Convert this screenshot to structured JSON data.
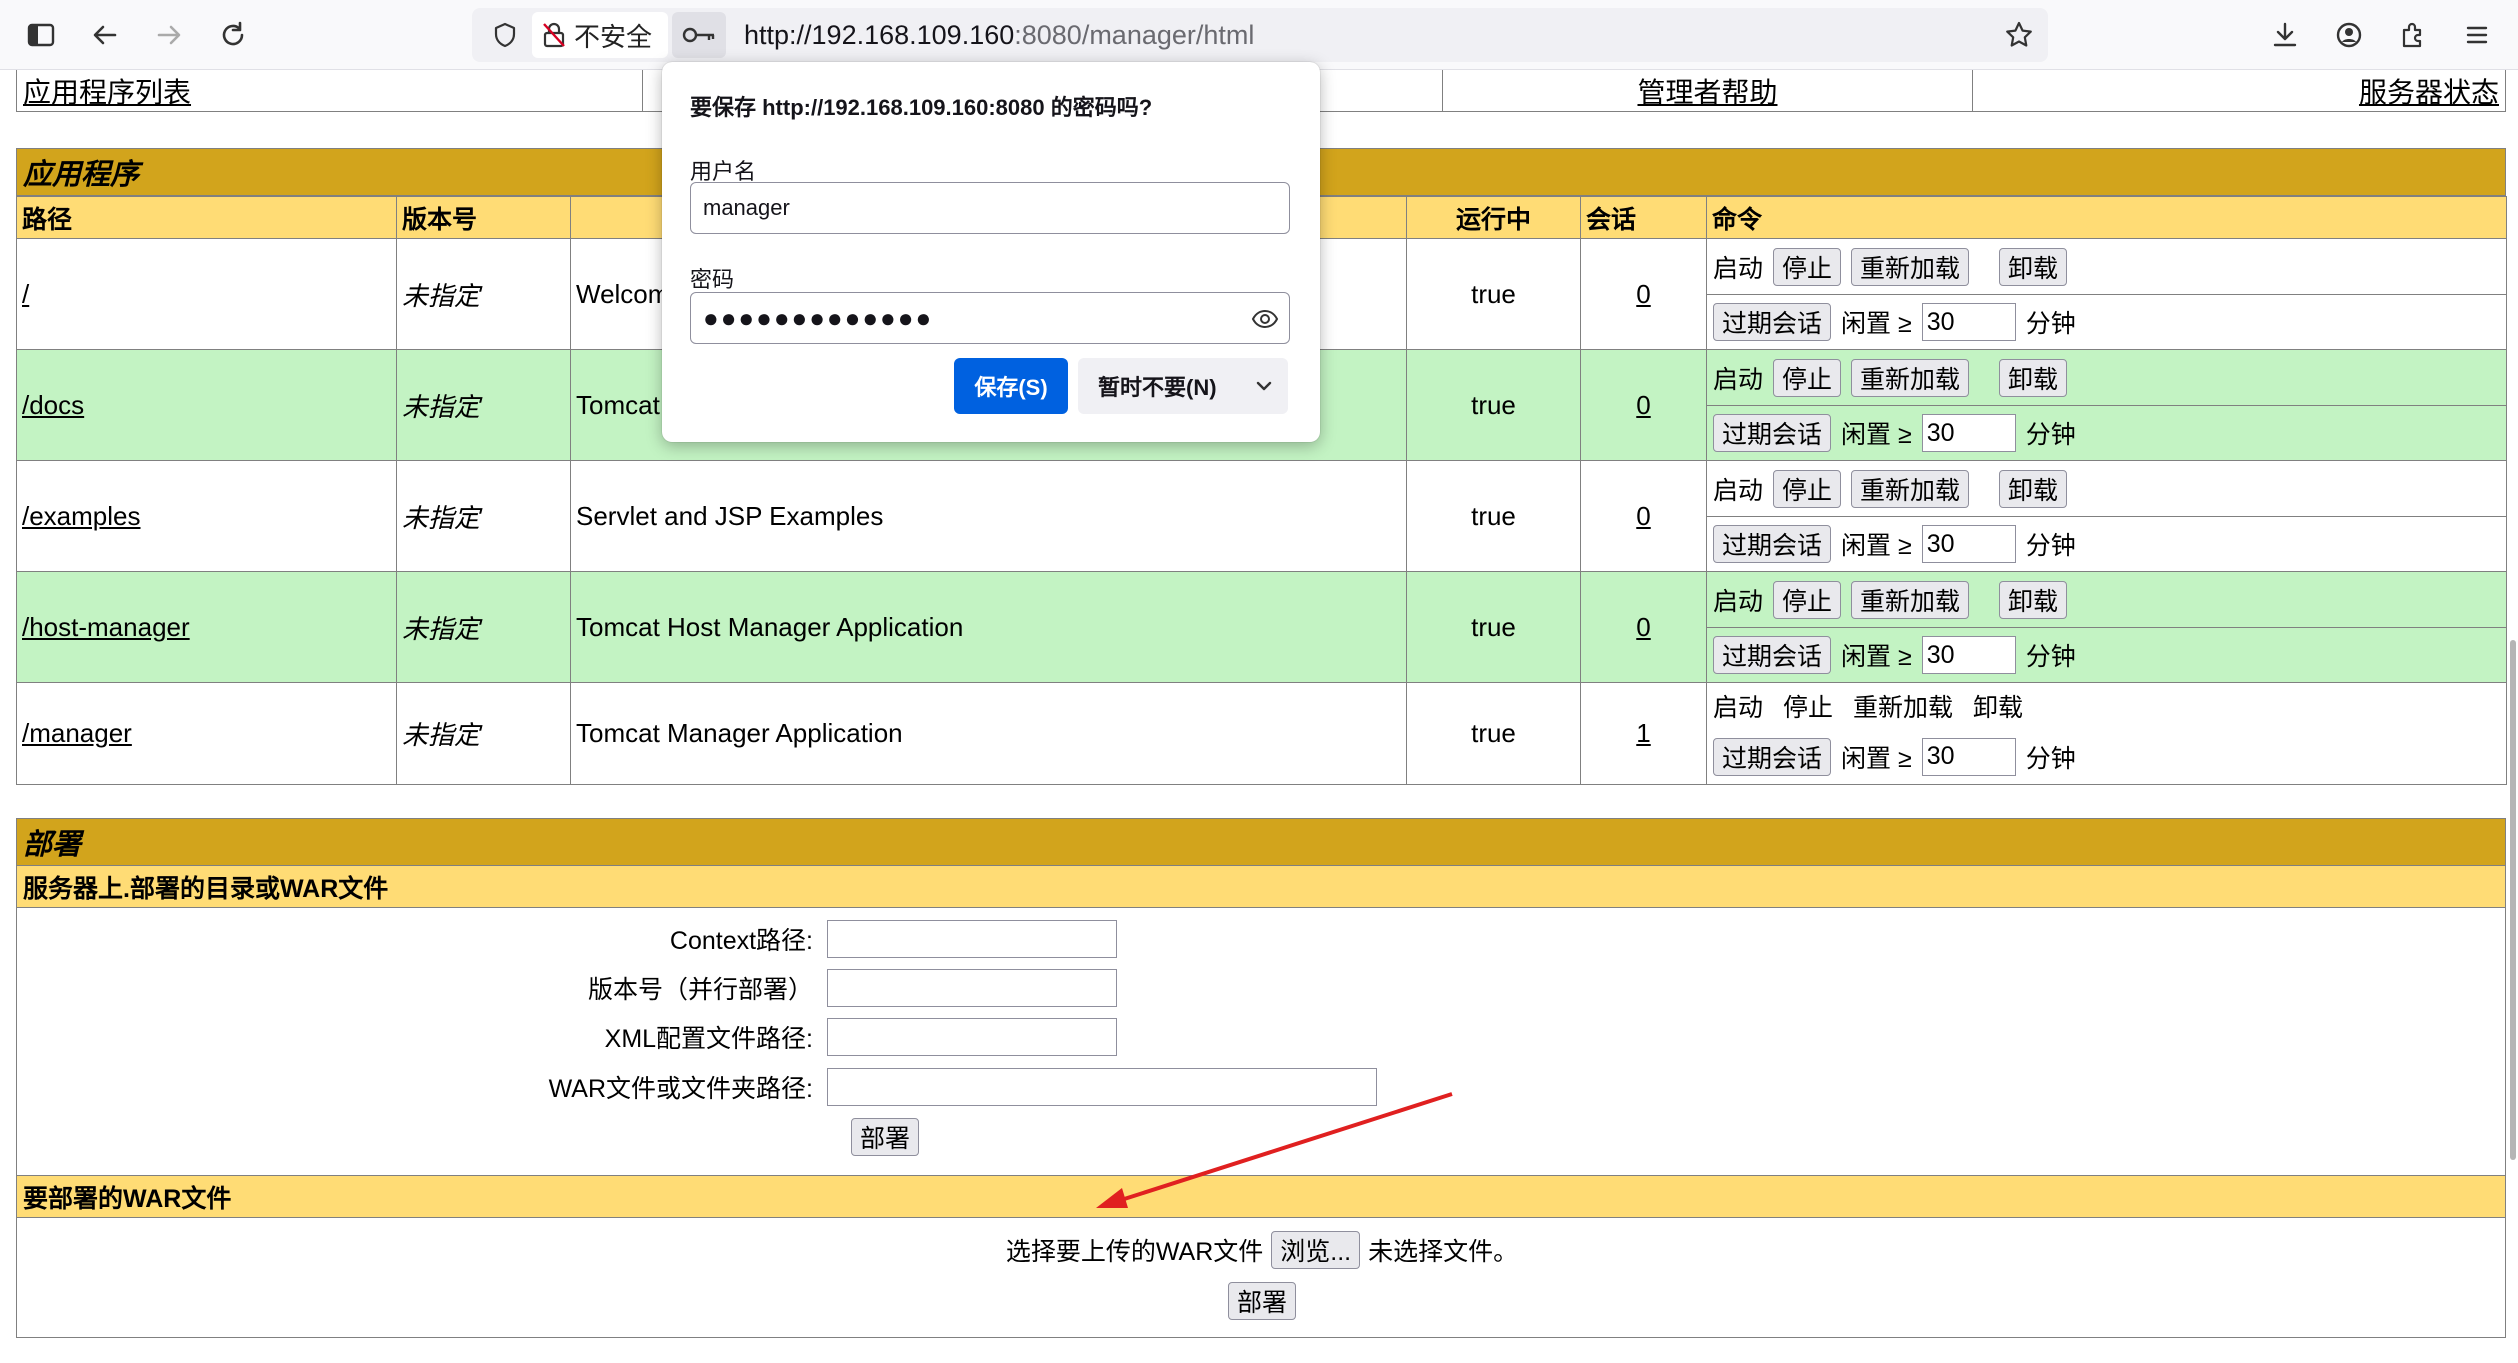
{
  "browser": {
    "security_label": "不安全",
    "url_host": "http://192.168.109.160",
    "url_rest": ":8080/manager/html"
  },
  "nav": {
    "app_list": "应用程序列表",
    "manager_help": "管理者帮助",
    "server_status": "服务器状态"
  },
  "applications": {
    "title": "应用程序",
    "headers": [
      "路径",
      "版本号",
      "",
      "运行中",
      "会话",
      "命令"
    ],
    "commands": {
      "start": "启动",
      "stop": "停止",
      "reload": "重新加载",
      "undeploy": "卸载",
      "expire": "过期会话",
      "idle": "闲置 ≥",
      "minutes": "分钟"
    },
    "rows": [
      {
        "path": "/",
        "version": "未指定",
        "name": "Welcom",
        "running": "true",
        "sessions": "0",
        "idle": "30"
      },
      {
        "path": "/docs",
        "version": "未指定",
        "name": "Tomcat",
        "running": "true",
        "sessions": "0",
        "idle": "30"
      },
      {
        "path": "/examples",
        "version": "未指定",
        "name": "Servlet and JSP Examples",
        "running": "true",
        "sessions": "0",
        "idle": "30"
      },
      {
        "path": "/host-manager",
        "version": "未指定",
        "name": "Tomcat Host Manager Application",
        "running": "true",
        "sessions": "0",
        "idle": "30"
      },
      {
        "path": "/manager",
        "version": "未指定",
        "name": "Tomcat Manager Application",
        "running": "true",
        "sessions": "1",
        "idle": "30"
      }
    ]
  },
  "deploy": {
    "title": "部署",
    "server_section": "服务器上.部署的目录或WAR文件",
    "context_label": "Context路径:",
    "version_label": "版本号（并行部署）",
    "xml_label": "XML配置文件路径:",
    "war_label": "WAR文件或文件夹路径:",
    "deploy_button": "部署",
    "war_section": "要部署的WAR文件",
    "choose_label": "选择要上传的WAR文件",
    "browse_button": "浏览...",
    "no_file": "未选择文件。",
    "upload_deploy_button": "部署"
  },
  "password_prompt": {
    "title": "要保存 http://192.168.109.160:8080 的密码吗?",
    "username_label": "用户名",
    "username_value": "manager",
    "password_label": "密码",
    "password_value": "●●●●●●●●●●●●●",
    "save_button": "保存(S)",
    "not_now_button": "暂时不要(N)"
  },
  "colors": {
    "section_header": "#d2a41c",
    "subheader": "#ffdc75",
    "row_highlight": "#c3f3c3",
    "save_button": "#0061e0",
    "arrow": "#e02020"
  },
  "icons": [
    "sidebar-icon",
    "back-icon",
    "forward-icon",
    "reload-icon",
    "shield-icon",
    "insecure-lock-icon",
    "key-icon",
    "star-icon",
    "download-icon",
    "account-icon",
    "extensions-icon",
    "menu-icon",
    "eye-icon",
    "chevron-down-icon"
  ]
}
